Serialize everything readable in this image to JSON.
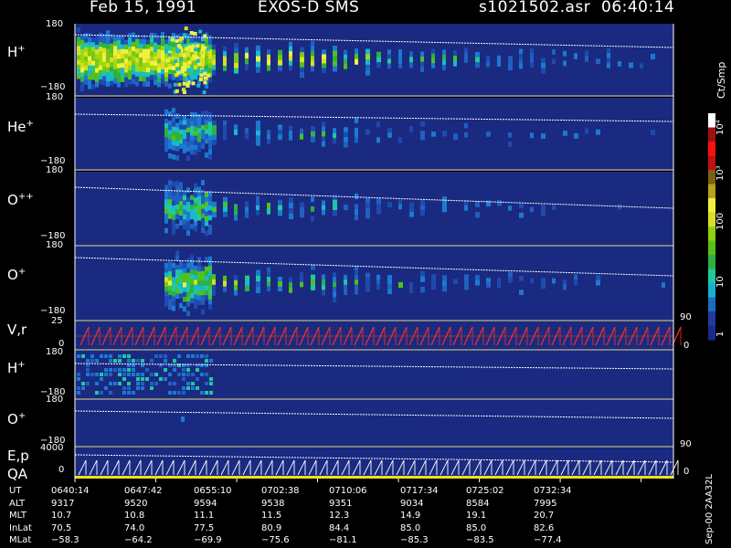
{
  "header": {
    "date": "Feb 15, 1991",
    "mission": "EXOS-D SMS",
    "file": "s1021502.asr",
    "time": "06:40:14"
  },
  "panels": [
    {
      "label": "H",
      "sup": "+",
      "ymax": "180",
      "ymin": "−180"
    },
    {
      "label": "He",
      "sup": "+",
      "ymax": "180",
      "ymin": "−180"
    },
    {
      "label": "O",
      "sup": "++",
      "ymax": "180",
      "ymin": "−180"
    },
    {
      "label": "O",
      "sup": "+",
      "ymax": "180",
      "ymin": "−180"
    }
  ],
  "vr_panel": {
    "label": "V,r",
    "ymax": "25",
    "ymin": "0",
    "rmax": "90",
    "rmin": "0"
  },
  "lower_panels": [
    {
      "label": "H",
      "sup": "+",
      "ymax": "180",
      "ymin": "−180"
    },
    {
      "label": "O",
      "sup": "+",
      "ymax": "180",
      "ymin": "−180"
    }
  ],
  "ep_panel": {
    "label": "E,p",
    "label2": "QA",
    "ymax": "4000",
    "ymin": "0",
    "rmax": "90",
    "rmin": "0"
  },
  "colorbar": {
    "title": "Ct/Smp",
    "ticks": [
      "10⁴",
      "10³",
      "100",
      "10",
      "1"
    ],
    "colors": [
      "#1a2a8a",
      "#1e3c9e",
      "#1a6ec0",
      "#18b0d0",
      "#20c8a0",
      "#30b040",
      "#58c018",
      "#90d010",
      "#d8e020",
      "#f0f040",
      "#b8a020",
      "#7a6010",
      "#c01010",
      "#ff1010",
      "#a01010",
      "#ffffff"
    ]
  },
  "footer_stamp": "Sep-00  2AA32L",
  "ephemeris": {
    "labels": [
      "UT",
      "ALT",
      "MLT",
      "InLat",
      "MLat"
    ],
    "columns": [
      [
        "0640:14",
        "9317",
        "10.7",
        "70.5",
        "−58.3"
      ],
      [
        "0647:42",
        "9520",
        "10.8",
        "74.0",
        "−64.2"
      ],
      [
        "0655:10",
        "9594",
        "11.1",
        "77.5",
        "−69.9"
      ],
      [
        "0702:38",
        "9538",
        "11.5",
        "80.9",
        "−75.6"
      ],
      [
        "0710:06",
        "9351",
        "12.3",
        "84.4",
        "−81.1"
      ],
      [
        "0717:34",
        "9034",
        "14.9",
        "85.0",
        "−85.3"
      ],
      [
        "0725:02",
        "8584",
        "19.1",
        "85.0",
        "−83.5"
      ],
      [
        "0732:34",
        "7995",
        "20.7",
        "82.6",
        "−77.4"
      ]
    ]
  },
  "chart_data": {
    "type": "heatmap",
    "title": "Feb 15, 1991   EXOS-D SMS",
    "x_ticks": [
      "0640:14",
      "0647:42",
      "0655:10",
      "0702:38",
      "0710:06",
      "0717:34",
      "0725:02",
      "0732:34"
    ],
    "series": [
      {
        "name": "H+",
        "ylim": [
          -180,
          180
        ],
        "peak_level": "100-1000"
      },
      {
        "name": "He+",
        "ylim": [
          -180,
          180
        ],
        "peak_level": "10-100"
      },
      {
        "name": "O++",
        "ylim": [
          -180,
          180
        ],
        "peak_level": "10-100"
      },
      {
        "name": "O+",
        "ylim": [
          -180,
          180
        ],
        "peak_level": "10-100"
      },
      {
        "name": "V,r",
        "ylim": [
          0,
          25
        ],
        "rlim": [
          0,
          90
        ]
      },
      {
        "name": "H+",
        "ylim": [
          -180,
          180
        ],
        "peak_level": "10"
      },
      {
        "name": "O+",
        "ylim": [
          -180,
          180
        ],
        "peak_level": "1-10"
      },
      {
        "name": "E,p",
        "ylim": [
          0,
          4000
        ],
        "rlim": [
          0,
          90
        ]
      }
    ],
    "colorbar_range": [
      1,
      10000
    ],
    "colorbar_label": "Ct/Smp"
  }
}
